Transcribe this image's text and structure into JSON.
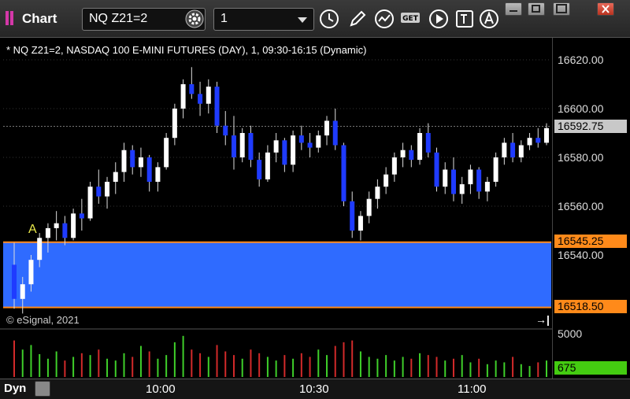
{
  "app": {
    "title": "Chart"
  },
  "toolbar": {
    "symbol": "NQ Z21=2",
    "interval": "1",
    "get_label": "GET"
  },
  "chart": {
    "legend": "* NQ Z21=2, NASDAQ 100 E-MINI FUTURES (DAY), 1, 09:30-16:15 (Dynamic)",
    "copyright": "© eSignal, 2021",
    "annotation": "A",
    "price_ticks": [
      "16620.00",
      "16600.00",
      "16580.00",
      "16560.00",
      "16540.00"
    ],
    "last_price": "16592.75",
    "range_high": "16545.25",
    "range_low": "16518.50",
    "volume_tick": "5000",
    "last_volume": "675",
    "time_labels": [
      "10:00",
      "10:30",
      "11:00"
    ],
    "time_mode": "Dyn"
  },
  "chart_data": {
    "type": "candlestick",
    "symbol": "NQ Z21=2",
    "interval": "1",
    "session": "09:30-16:15",
    "ylim": [
      16512,
      16625
    ],
    "range_band": {
      "high": 16545.25,
      "low": 16518.5,
      "color": "#2f6bff"
    },
    "last_price": 16592.75,
    "x_ticks": [
      "10:00",
      "10:30",
      "11:00"
    ],
    "candles": [
      [
        16536,
        16545,
        16518,
        16522
      ],
      [
        16522,
        16531,
        16516,
        16528
      ],
      [
        16528,
        16540,
        16525,
        16538
      ],
      [
        16538,
        16549,
        16535,
        16547
      ],
      [
        16547,
        16553,
        16541,
        16551
      ],
      [
        16551,
        16558,
        16546,
        16553
      ],
      [
        16553,
        16556,
        16544,
        16547
      ],
      [
        16547,
        16559,
        16546,
        16557
      ],
      [
        16557,
        16563,
        16550,
        16555
      ],
      [
        16555,
        16570,
        16554,
        16568
      ],
      [
        16568,
        16575,
        16561,
        16564
      ],
      [
        16564,
        16572,
        16559,
        16570
      ],
      [
        16570,
        16578,
        16565,
        16574
      ],
      [
        16574,
        16586,
        16570,
        16583
      ],
      [
        16583,
        16585,
        16573,
        16576
      ],
      [
        16576,
        16584,
        16572,
        16580
      ],
      [
        16580,
        16581,
        16566,
        16570
      ],
      [
        16570,
        16578,
        16566,
        16576
      ],
      [
        16576,
        16590,
        16575,
        16588
      ],
      [
        16588,
        16602,
        16585,
        16600
      ],
      [
        16600,
        16612,
        16596,
        16610
      ],
      [
        16610,
        16617,
        16604,
        16606
      ],
      [
        16606,
        16611,
        16597,
        16602
      ],
      [
        16602,
        16612,
        16598,
        16609
      ],
      [
        16609,
        16611,
        16590,
        16593
      ],
      [
        16593,
        16599,
        16585,
        16589
      ],
      [
        16589,
        16597,
        16575,
        16580
      ],
      [
        16580,
        16592,
        16578,
        16590
      ],
      [
        16590,
        16593,
        16576,
        16579
      ],
      [
        16579,
        16582,
        16568,
        16571
      ],
      [
        16571,
        16585,
        16570,
        16582
      ],
      [
        16582,
        16590,
        16578,
        16587
      ],
      [
        16587,
        16588,
        16574,
        16577
      ],
      [
        16577,
        16591,
        16574,
        16589
      ],
      [
        16589,
        16593,
        16583,
        16586
      ],
      [
        16586,
        16590,
        16580,
        16584
      ],
      [
        16584,
        16591,
        16582,
        16589
      ],
      [
        16589,
        16597,
        16585,
        16595
      ],
      [
        16595,
        16600,
        16583,
        16585
      ],
      [
        16585,
        16586,
        16560,
        16562
      ],
      [
        16562,
        16566,
        16547,
        16550
      ],
      [
        16550,
        16558,
        16546,
        16556
      ],
      [
        16556,
        16566,
        16553,
        16563
      ],
      [
        16563,
        16571,
        16559,
        16568
      ],
      [
        16568,
        16576,
        16565,
        16573
      ],
      [
        16573,
        16582,
        16570,
        16580
      ],
      [
        16580,
        16586,
        16576,
        16583
      ],
      [
        16583,
        16585,
        16576,
        16579
      ],
      [
        16579,
        16592,
        16577,
        16590
      ],
      [
        16590,
        16594,
        16580,
        16582
      ],
      [
        16582,
        16584,
        16566,
        16568
      ],
      [
        16568,
        16578,
        16565,
        16575
      ],
      [
        16575,
        16580,
        16562,
        16565
      ],
      [
        16565,
        16572,
        16561,
        16569
      ],
      [
        16569,
        16577,
        16565,
        16575
      ],
      [
        16575,
        16576,
        16563,
        16566
      ],
      [
        16566,
        16572,
        16562,
        16570
      ],
      [
        16570,
        16582,
        16568,
        16580
      ],
      [
        16580,
        16588,
        16577,
        16586
      ],
      [
        16586,
        16590,
        16578,
        16580
      ],
      [
        16580,
        16587,
        16578,
        16585
      ],
      [
        16585,
        16590,
        16583,
        16588
      ],
      [
        16588,
        16592,
        16584,
        16586
      ],
      [
        16586,
        16594,
        16585,
        16592
      ]
    ],
    "volume": [
      40,
      30,
      35,
      25,
      20,
      28,
      18,
      22,
      26,
      24,
      30,
      20,
      18,
      26,
      22,
      34,
      28,
      20,
      24,
      38,
      45,
      30,
      26,
      22,
      35,
      28,
      24,
      20,
      30,
      26,
      22,
      18,
      24,
      20,
      26,
      22,
      30,
      24,
      34,
      38,
      40,
      28,
      22,
      20,
      24,
      18,
      22,
      20,
      26,
      24,
      22,
      18,
      20,
      24,
      16,
      20,
      14,
      18,
      16,
      22,
      14,
      12,
      16,
      18
    ]
  }
}
